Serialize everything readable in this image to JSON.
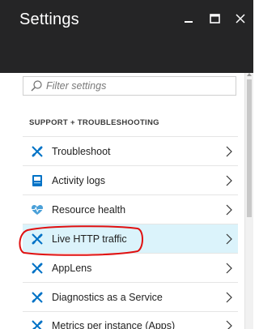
{
  "header": {
    "title": "Settings"
  },
  "window_controls": [
    "minimize-icon",
    "maximize-icon",
    "close-icon"
  ],
  "filter": {
    "placeholder": "Filter settings",
    "value": ""
  },
  "section": {
    "heading": "SUPPORT + TROUBLESHOOTING"
  },
  "items": [
    {
      "label": "Troubleshoot",
      "icon": "wrench-icon",
      "icon_color": "#0072c6"
    },
    {
      "label": "Activity logs",
      "icon": "log-book-icon",
      "icon_color": "#0072c6"
    },
    {
      "label": "Resource health",
      "icon": "heart-pulse-icon",
      "icon_color": "#4aa0d8"
    },
    {
      "label": "Live HTTP traffic",
      "icon": "wrench-icon",
      "icon_color": "#0072c6",
      "selected": true
    },
    {
      "label": "AppLens",
      "icon": "wrench-icon",
      "icon_color": "#0072c6"
    },
    {
      "label": "Diagnostics as a Service",
      "icon": "wrench-icon",
      "icon_color": "#0072c6"
    },
    {
      "label": "Metrics per instance (Apps)",
      "icon": "wrench-icon",
      "icon_color": "#0072c6"
    }
  ],
  "colors": {
    "header_bg": "#252526",
    "selected_bg": "#dbf3fb",
    "annotation": "#e01010"
  }
}
